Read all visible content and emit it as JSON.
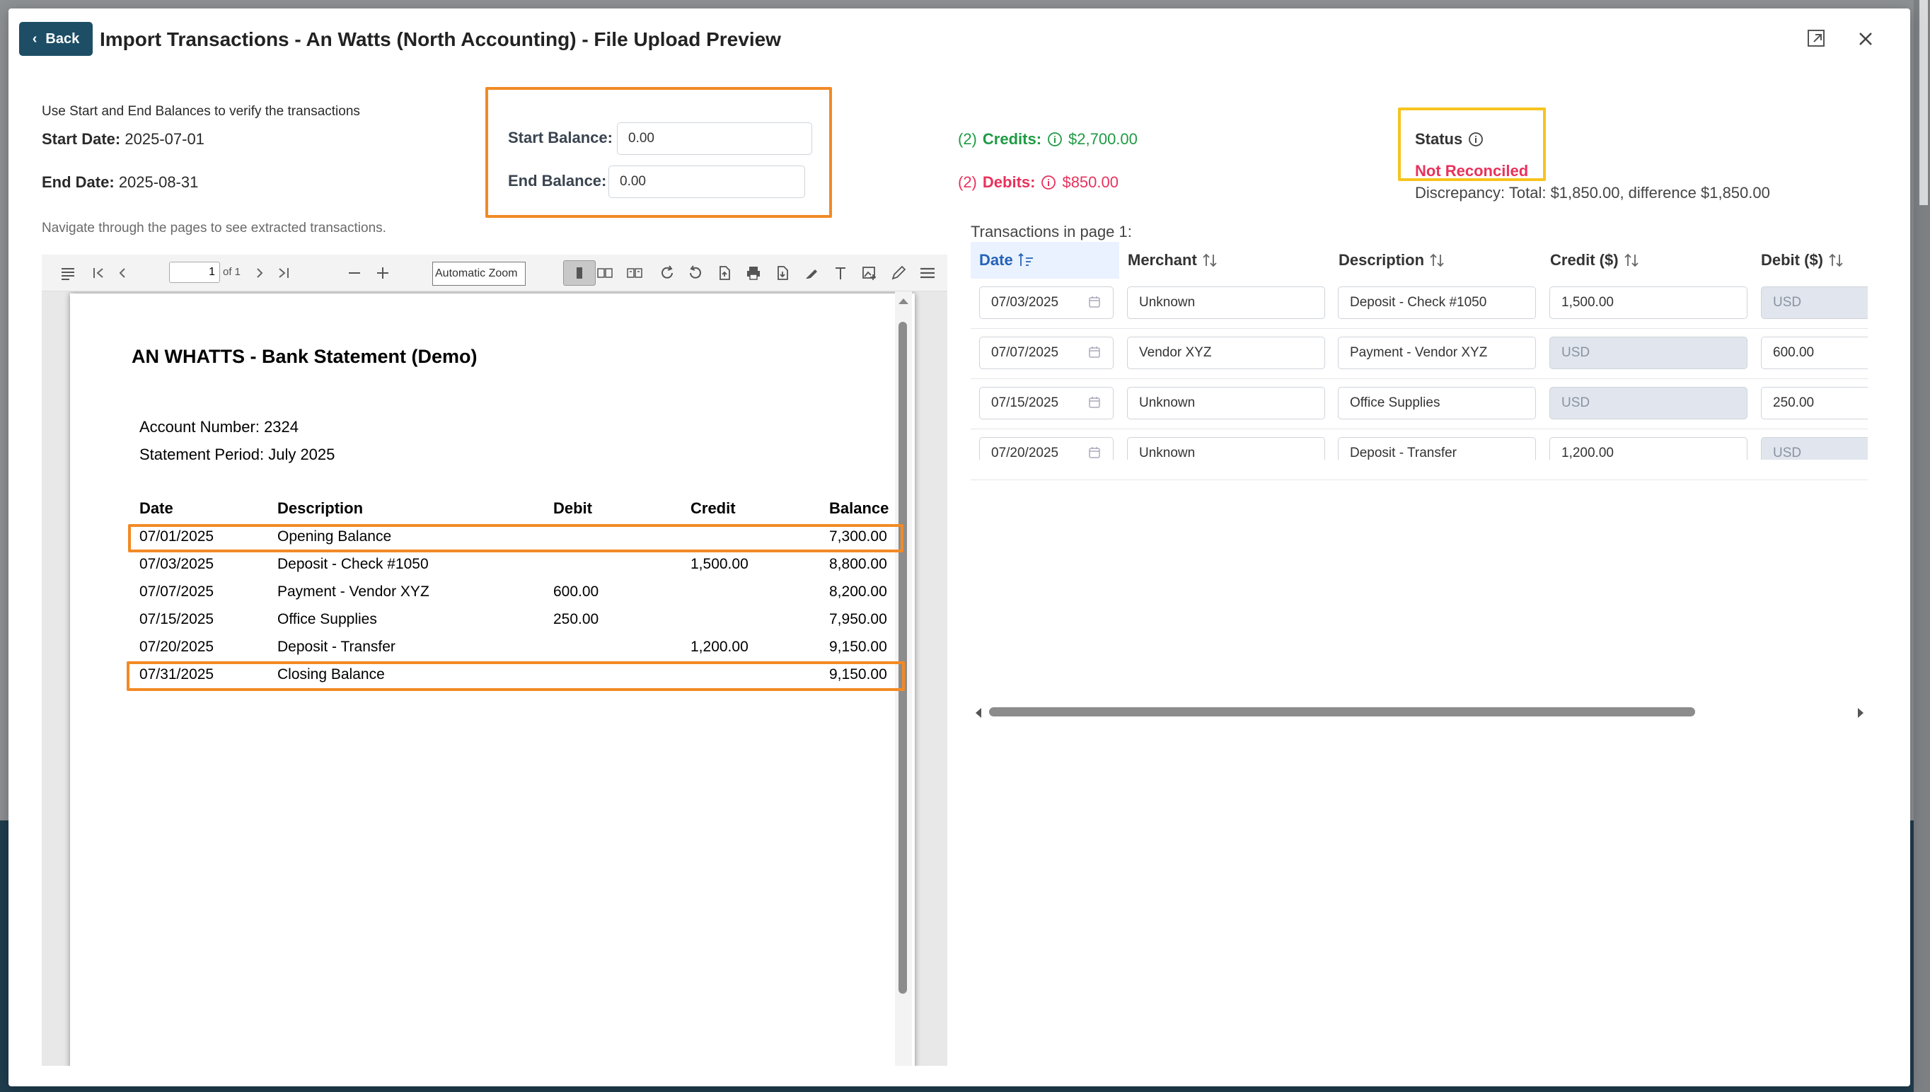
{
  "modal": {
    "back_label": "Back",
    "title": "Import Transactions - An Watts (North Accounting) - File Upload Preview"
  },
  "verify": {
    "hint": "Use Start and End Balances to verify the transactions",
    "start_date_label": "Start Date:",
    "start_date_value": "2025-07-01",
    "end_date_label": "End Date:",
    "end_date_value": "2025-08-31",
    "nav_hint": "Navigate through the pages to see extracted transactions."
  },
  "balances": {
    "start_label": "Start Balance:",
    "start_value": "0.00",
    "end_label": "End Balance:",
    "end_value": "0.00"
  },
  "summary": {
    "credits_count": "(2)",
    "credits_label": "Credits:",
    "credits_amount": "$2,700.00",
    "debits_count": "(2)",
    "debits_label": "Debits:",
    "debits_amount": "$850.00",
    "status_label": "Status",
    "status_value": "Not Reconciled",
    "discrepancy": "Discrepancy: Total: $1,850.00, difference $1,850.00",
    "status_color": "#e8325c",
    "credit_color": "#1f9a44"
  },
  "pdf_viewer": {
    "page_number": "1",
    "page_of": "of 1",
    "zoom": "Automatic Zoom"
  },
  "statement": {
    "title": "AN WHATTS - Bank Statement (Demo)",
    "account": "Account Number: 2324",
    "period": "Statement Period: July 2025",
    "headers": [
      "Date",
      "Description",
      "Debit",
      "Credit",
      "Balance"
    ],
    "rows": [
      [
        "07/01/2025",
        "Opening Balance",
        "",
        "",
        "7,300.00"
      ],
      [
        "07/03/2025",
        "Deposit - Check #1050",
        "",
        "1,500.00",
        "8,800.00"
      ],
      [
        "07/07/2025",
        "Payment - Vendor XYZ",
        "600.00",
        "",
        "8,200.00"
      ],
      [
        "07/15/2025",
        "Office Supplies",
        "250.00",
        "",
        "7,950.00"
      ],
      [
        "07/20/2025",
        "Deposit - Transfer",
        "",
        "1,200.00",
        "9,150.00"
      ],
      [
        "07/31/2025",
        "Closing Balance",
        "",
        "",
        "9,150.00"
      ]
    ]
  },
  "transactions": {
    "caption": "Transactions in page 1:",
    "headers": [
      "Date",
      "Merchant",
      "Description",
      "Credit ($)",
      "Debit ($)"
    ],
    "rows": [
      {
        "date": "07/03/2025",
        "merchant": "Unknown",
        "description": "Deposit - Check #1050",
        "credit": "1,500.00",
        "debit": "USD"
      },
      {
        "date": "07/07/2025",
        "merchant": "Vendor XYZ",
        "description": "Payment - Vendor XYZ",
        "credit": "USD",
        "debit": "600.00"
      },
      {
        "date": "07/15/2025",
        "merchant": "Unknown",
        "description": "Office Supplies",
        "credit": "USD",
        "debit": "250.00"
      },
      {
        "date": "07/20/2025",
        "merchant": "Unknown",
        "description": "Deposit - Transfer",
        "credit": "1,200.00",
        "debit": "USD"
      }
    ]
  },
  "icons": {
    "back": "chevron-left-icon",
    "expand": "expand-icon",
    "close": "close-icon",
    "info": "info-icon",
    "calendar": "calendar-icon",
    "sort": "sort-icon"
  }
}
